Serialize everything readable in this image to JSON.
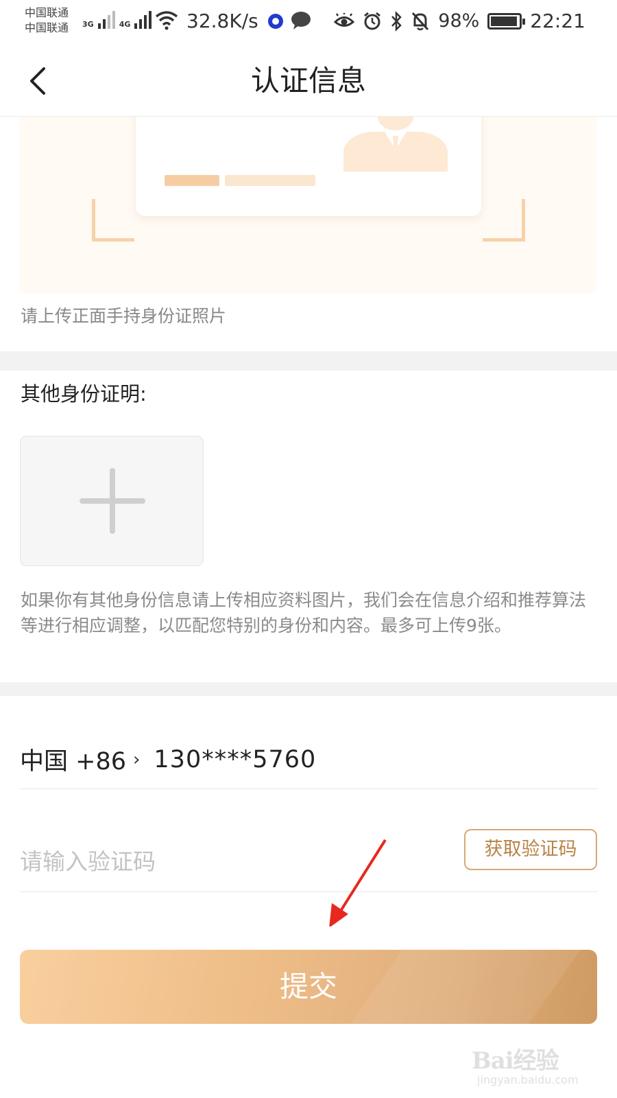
{
  "status_bar": {
    "carrier_1": "中国联通",
    "carrier_2": "中国联通",
    "net_type_1": "3G",
    "net_type_2": "4G",
    "speed": "32.8K/s",
    "battery_percent": "98%",
    "time": "22:21",
    "icons": [
      "signal-icon",
      "wifi-icon",
      "app-notification-icon",
      "chat-bubble-icon",
      "eye-icon",
      "alarm-icon",
      "bluetooth-icon",
      "mute-bell-icon",
      "battery-icon"
    ]
  },
  "header": {
    "title": "认证信息",
    "back_icon": "chevron-left-icon"
  },
  "id_upload": {
    "hint": "请上传正面手持身份证照片"
  },
  "other_proof": {
    "label": "其他身份证明:",
    "add_icon": "plus-icon",
    "description": "如果你有其他身份信息请上传相应资料图片，我们会在信息介绍和推荐算法等进行相应调整，以匹配您特别的身份和内容。最多可上传9张。"
  },
  "phone": {
    "country": "中国 +86",
    "number": "130****5760"
  },
  "verification": {
    "placeholder": "请输入验证码",
    "get_code_label": "获取验证码"
  },
  "submit": {
    "label": "提交"
  },
  "watermark": {
    "main": "Bai经验",
    "sub": "jingyan.baidu.com"
  },
  "colors": {
    "accent": "#d7a877",
    "accent_text": "#b98346",
    "submit_start": "#f9cf9e",
    "submit_end": "#cf9a62",
    "annotation_arrow": "#e8281f"
  }
}
